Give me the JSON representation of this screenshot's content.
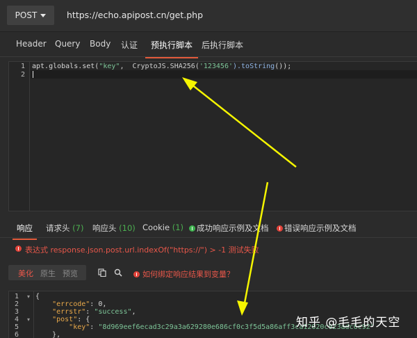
{
  "request": {
    "method": "POST",
    "url": "https://echo.apipost.cn/get.php"
  },
  "request_tabs": [
    {
      "label": "Header"
    },
    {
      "label": "Query"
    },
    {
      "label": "Body"
    },
    {
      "label": "认证"
    },
    {
      "label": "预执行脚本"
    },
    {
      "label": "后执行脚本"
    }
  ],
  "editor": {
    "line_numbers": [
      "1",
      "2"
    ],
    "line1": {
      "prefix": "apt.globals.set(",
      "arg1": "\"key\"",
      "mid": ",  CryptoJS.SHA256(",
      "arg2": "'123456'",
      "method": ").toString",
      "suffix": "());"
    }
  },
  "response_tabs": [
    {
      "label": "响应"
    },
    {
      "label": "请求头",
      "count": "(7)"
    },
    {
      "label": "响应头",
      "count": "(10)"
    },
    {
      "label": "Cookie",
      "count": "(1)"
    },
    {
      "label": "成功响应示例及文档"
    },
    {
      "label": "错误响应示例及文档"
    }
  ],
  "assertion_error": "表达式 response.json.post.url.indexOf(\"https://\") > -1 测试失败",
  "format_buttons": [
    "美化",
    "原生",
    "预览"
  ],
  "bind_link": "如何绑定响应结果到变量？",
  "response": {
    "line_numbers": [
      "1",
      "2",
      "3",
      "4",
      "5",
      "6"
    ],
    "lines": [
      {
        "text": "{"
      },
      {
        "key": "\"errcode\"",
        "value": "0"
      },
      {
        "key": "\"errstr\"",
        "value": "\"success\""
      },
      {
        "key": "\"post\"",
        "text": "{"
      },
      {
        "key": "\"key\"",
        "value": "\"8d969eef6ecad3c29a3a629280e686cf0c3f5d5a86aff3ca12020c923adc6c92\""
      },
      {
        "text": "},"
      }
    ]
  },
  "watermark": "知乎 @毛毛的天空",
  "colors": {
    "accent_tab": "#e35a3b",
    "error_red": "#e8574a",
    "success_green": "#3fb34f",
    "arrow_yellow": "#f5f500"
  }
}
